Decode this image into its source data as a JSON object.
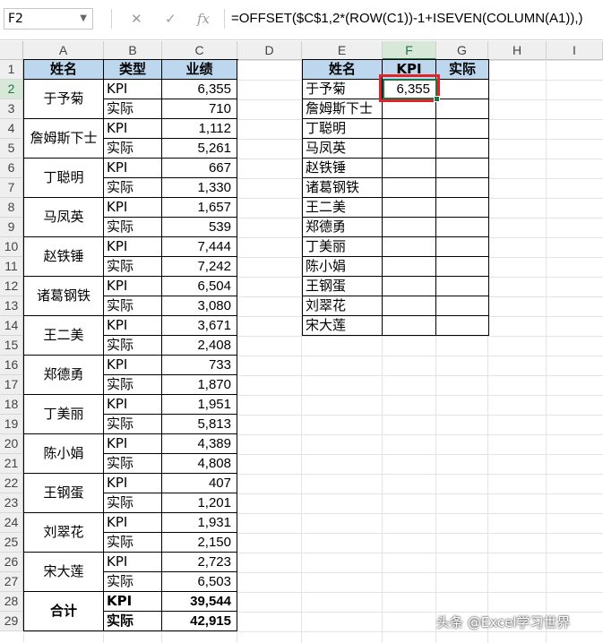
{
  "formula_bar": {
    "name_box": "F2",
    "formula": "=OFFSET($C$1,2*(ROW(C1))-1+ISEVEN(COLUMN(A1)),)",
    "cancel_glyph": "✕",
    "enter_glyph": "✓",
    "fx_glyph": "fx"
  },
  "columns": [
    "A",
    "B",
    "C",
    "D",
    "E",
    "F",
    "G",
    "H",
    "I"
  ],
  "selected_column": "F",
  "rows": [
    "1",
    "2",
    "3",
    "4",
    "5",
    "6",
    "7",
    "8",
    "9",
    "10",
    "11",
    "12",
    "13",
    "14",
    "15",
    "16",
    "17",
    "18",
    "19",
    "20",
    "21",
    "22",
    "23",
    "24",
    "25",
    "26",
    "27",
    "28",
    "29"
  ],
  "selected_row": "2",
  "left_table": {
    "headers": [
      "姓名",
      "类型",
      "业绩"
    ],
    "groups": [
      {
        "name": "于予菊",
        "kpi": "6,355",
        "actual": "710"
      },
      {
        "name": "詹姆斯下士",
        "kpi": "1,112",
        "actual": "5,261"
      },
      {
        "name": "丁聪明",
        "kpi": "667",
        "actual": "1,330"
      },
      {
        "name": "马凤英",
        "kpi": "1,657",
        "actual": "539"
      },
      {
        "name": "赵铁锤",
        "kpi": "7,444",
        "actual": "7,242"
      },
      {
        "name": "诸葛钢铁",
        "kpi": "6,504",
        "actual": "3,080"
      },
      {
        "name": "王二美",
        "kpi": "3,671",
        "actual": "2,408"
      },
      {
        "name": "郑德勇",
        "kpi": "733",
        "actual": "1,870"
      },
      {
        "name": "丁美丽",
        "kpi": "1,951",
        "actual": "5,813"
      },
      {
        "name": "陈小娟",
        "kpi": "4,389",
        "actual": "4,808"
      },
      {
        "name": "王钢蛋",
        "kpi": "407",
        "actual": "1,201"
      },
      {
        "name": "刘翠花",
        "kpi": "1,931",
        "actual": "2,150"
      },
      {
        "name": "宋大莲",
        "kpi": "2,723",
        "actual": "6,503"
      }
    ],
    "type_kpi": "KPI",
    "type_actual": "实际",
    "total": {
      "label": "合计",
      "kpi_label": "KPI",
      "kpi": "39,544",
      "actual_label": "实际",
      "actual": "42,915"
    }
  },
  "right_table": {
    "headers": [
      "姓名",
      "KPI",
      "实际"
    ],
    "names": [
      "于予菊",
      "詹姆斯下士",
      "丁聪明",
      "马凤英",
      "赵铁锤",
      "诸葛钢铁",
      "王二美",
      "郑德勇",
      "丁美丽",
      "陈小娟",
      "王钢蛋",
      "刘翠花",
      "宋大莲"
    ],
    "f2_value": "6,355"
  },
  "watermark": "头条 @Excel学习世界",
  "colors": {
    "header_fill": "#bdd7ee",
    "selection": "#217346",
    "highlight": "#e0242a"
  }
}
